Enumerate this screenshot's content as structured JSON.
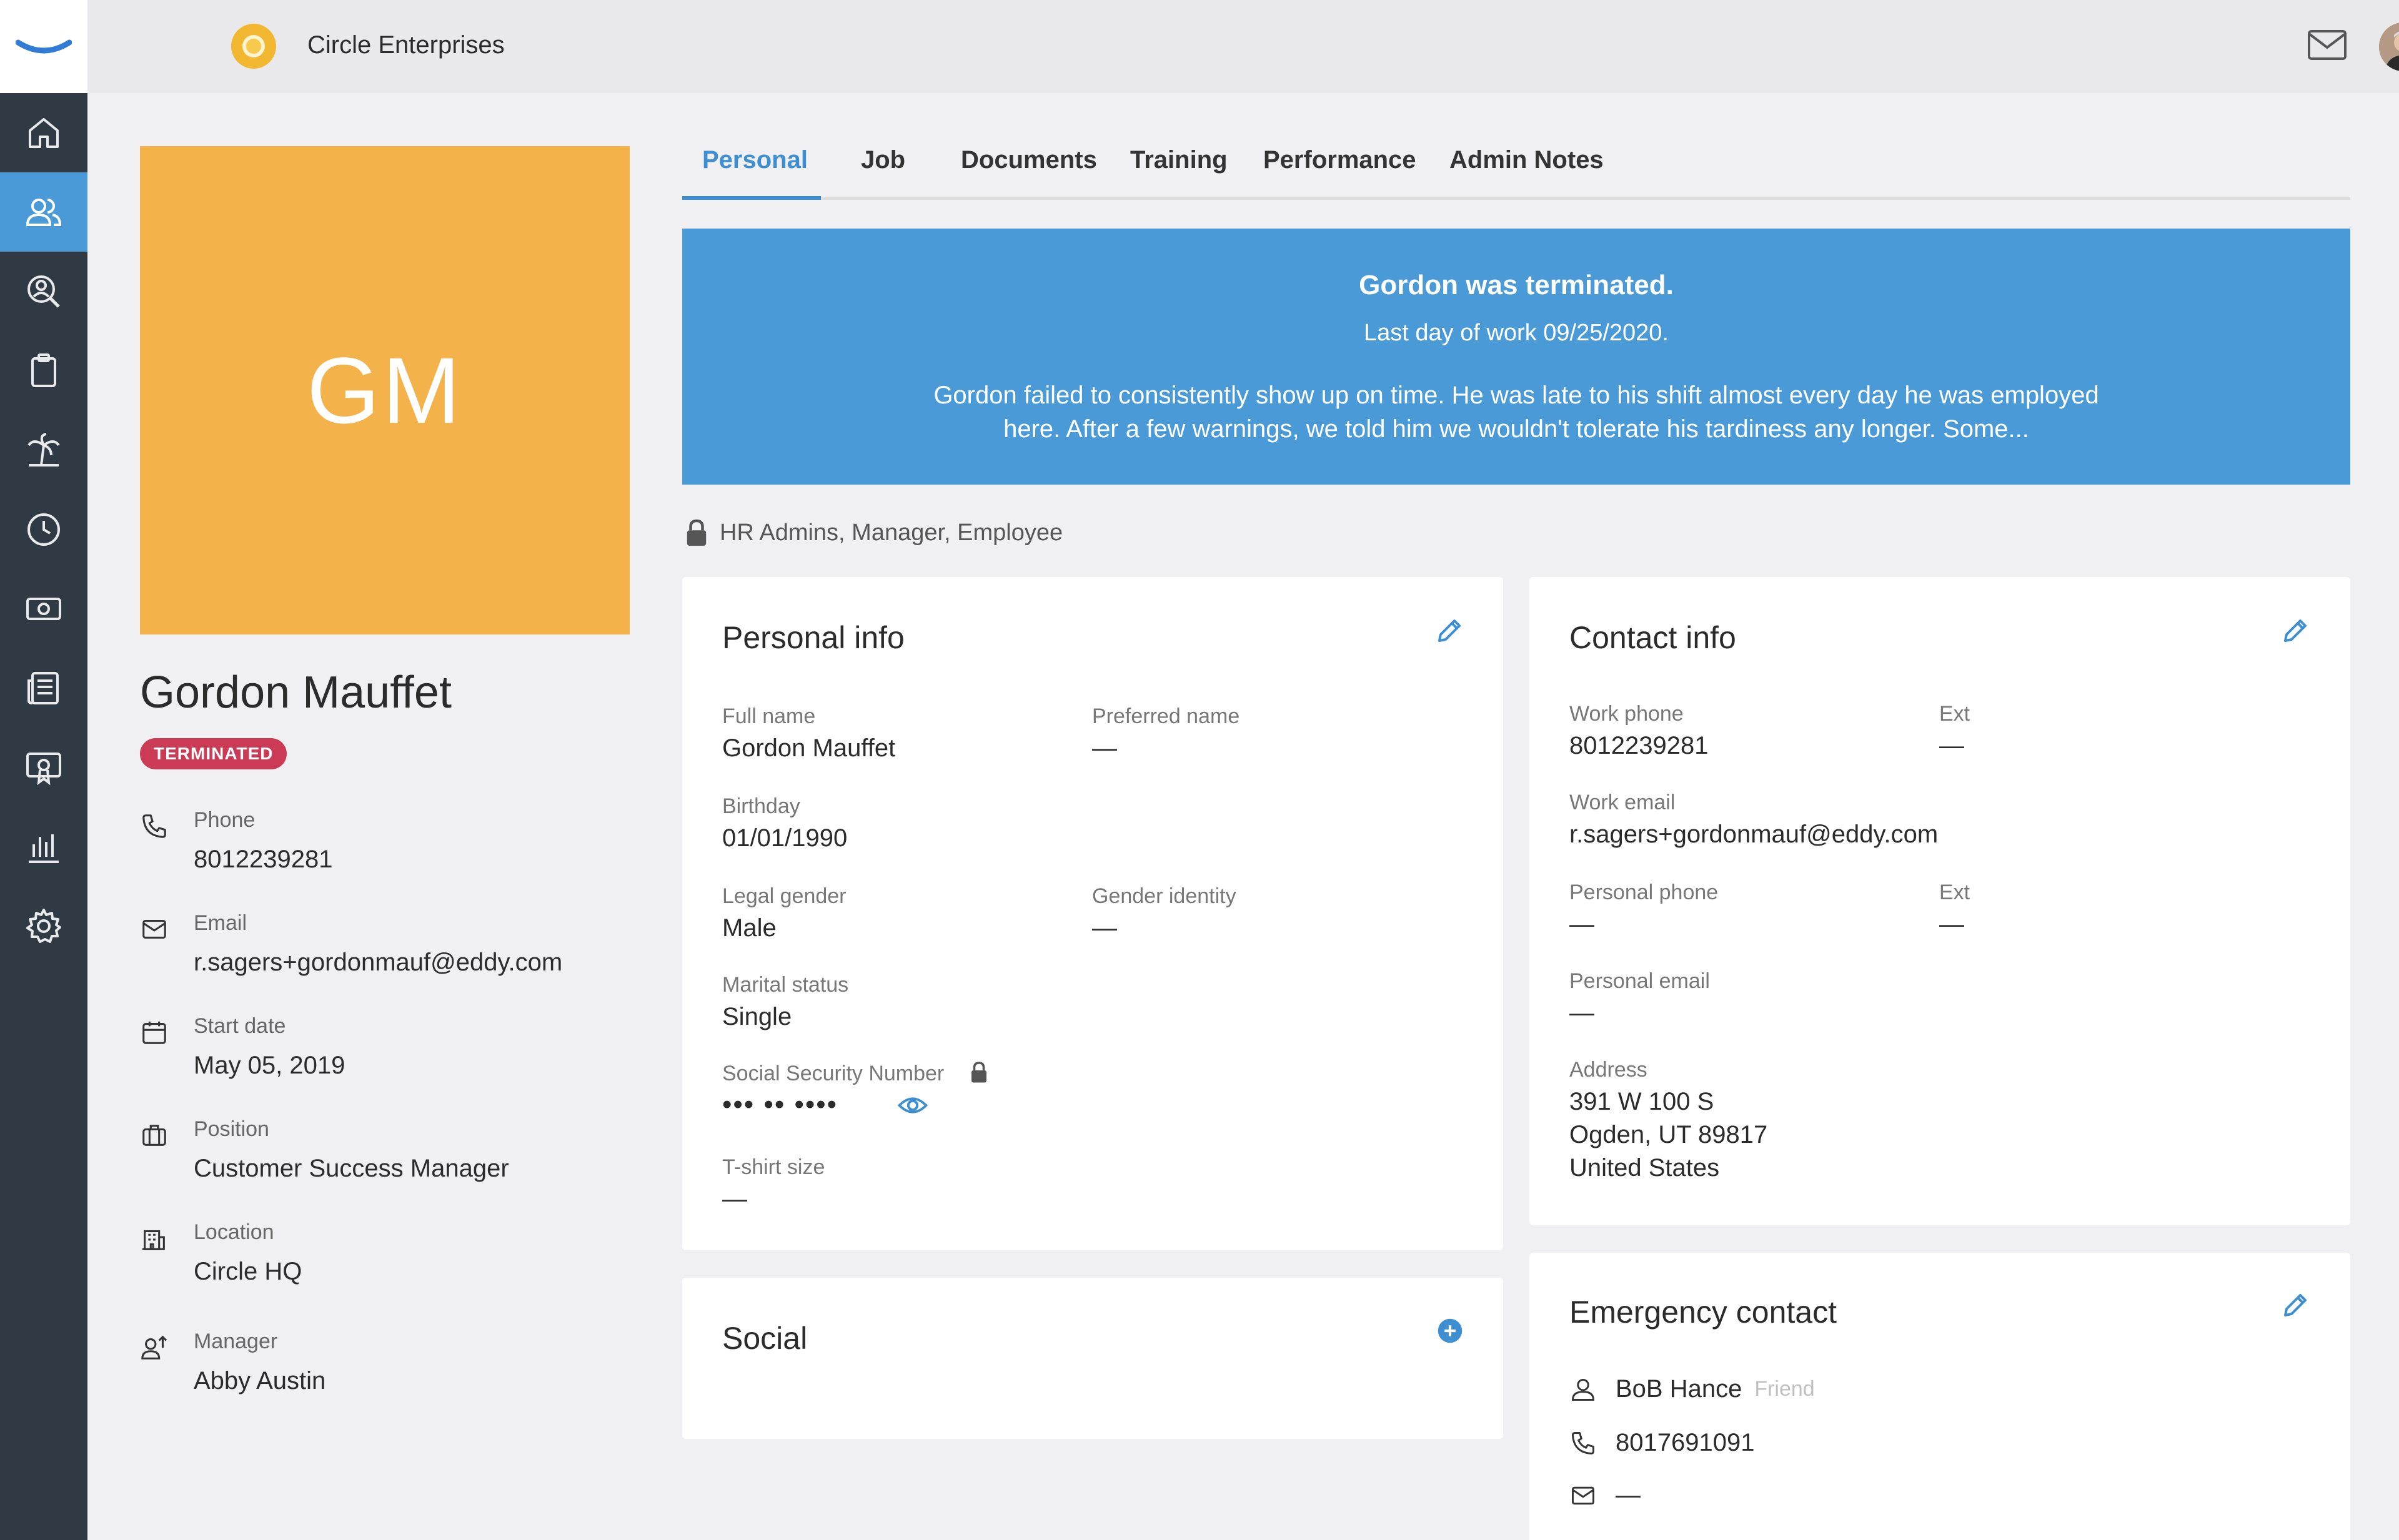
{
  "app": {
    "company_name": "Circle Enterprises",
    "brand_color": "#4a9ad8"
  },
  "nav": {
    "items": [
      {
        "icon": "home-icon",
        "active": false
      },
      {
        "icon": "people-icon",
        "active": true
      },
      {
        "icon": "search-person-icon",
        "active": false
      },
      {
        "icon": "clipboard-icon",
        "active": false
      },
      {
        "icon": "palm-tree-icon",
        "active": false
      },
      {
        "icon": "clock-icon",
        "active": false
      },
      {
        "icon": "money-icon",
        "active": false
      },
      {
        "icon": "news-icon",
        "active": false
      },
      {
        "icon": "certificate-icon",
        "active": false
      },
      {
        "icon": "reports-icon",
        "active": false
      },
      {
        "icon": "gear-icon",
        "active": false
      }
    ]
  },
  "profile": {
    "initials": "GM",
    "name": "Gordon Mauffet",
    "status": "TERMINATED",
    "fields": {
      "phone": {
        "label": "Phone",
        "value": "8012239281"
      },
      "email": {
        "label": "Email",
        "value": "r.sagers+gordonmauf@eddy.com"
      },
      "start": {
        "label": "Start date",
        "value": "May 05, 2019"
      },
      "position": {
        "label": "Position",
        "value": "Customer Success Manager"
      },
      "location": {
        "label": "Location",
        "value": "Circle HQ"
      },
      "manager": {
        "label": "Manager",
        "value": "Abby Austin"
      }
    }
  },
  "tabs": [
    "Personal",
    "Job",
    "Documents",
    "Training",
    "Performance",
    "Admin Notes"
  ],
  "banner": {
    "title": "Gordon was terminated.",
    "last_day": "Last day of work 09/25/2020.",
    "body": "Gordon failed to consistently show up on time. He was late to his shift almost every day he was employed here. After a few warnings, we told him we wouldn't tolerate his tardiness any longer. Some..."
  },
  "visibility": "HR Admins, Manager, Employee",
  "personal_info": {
    "title": "Personal info",
    "full_name_label": "Full name",
    "full_name": "Gordon Mauffet",
    "preferred_label": "Preferred name",
    "preferred": "—",
    "birthday_label": "Birthday",
    "birthday": "01/01/1990",
    "legal_gender_label": "Legal gender",
    "legal_gender": "Male",
    "gender_identity_label": "Gender identity",
    "gender_identity": "—",
    "marital_label": "Marital status",
    "marital": "Single",
    "ssn_label": "Social Security Number",
    "ssn": "••• •• ••••",
    "tshirt_label": "T-shirt size",
    "tshirt": "—"
  },
  "contact_info": {
    "title": "Contact info",
    "work_phone_label": "Work phone",
    "work_phone": "8012239281",
    "ext_label": "Ext",
    "work_ext": "—",
    "work_email_label": "Work email",
    "work_email": "r.sagers+gordonmauf@eddy.com",
    "personal_phone_label": "Personal phone",
    "personal_phone": "—",
    "personal_ext": "—",
    "personal_email_label": "Personal email",
    "personal_email": "—",
    "address_label": "Address",
    "address_line1": "391 W 100 S",
    "address_line2": "Ogden, UT 89817",
    "address_line3": "United States"
  },
  "social": {
    "title": "Social"
  },
  "emergency": {
    "title": "Emergency contact",
    "name": "BoB Hance",
    "relation": "Friend",
    "phone": "8017691091",
    "email": "—"
  }
}
